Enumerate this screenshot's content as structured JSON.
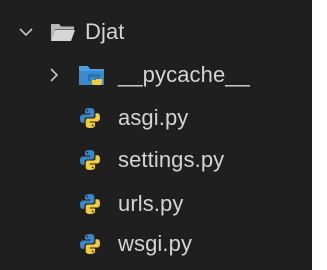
{
  "explorer": {
    "root_folder": {
      "name": "Djat",
      "expanded": true,
      "icon": "folder-open-icon"
    },
    "items": [
      {
        "name": "__pycache__",
        "type": "folder",
        "expanded": false,
        "icon": "pycache-folder-icon"
      },
      {
        "name": "asgi.py",
        "type": "file",
        "icon": "python-file-icon"
      },
      {
        "name": "settings.py",
        "type": "file",
        "icon": "python-file-icon"
      },
      {
        "name": "urls.py",
        "type": "file",
        "icon": "python-file-icon"
      },
      {
        "name": "wsgi.py",
        "type": "file",
        "icon": "python-file-icon"
      }
    ]
  },
  "colors": {
    "background": "#1f1f1f",
    "text": "#d4d4d4",
    "folder_gray": "#c5c5c5",
    "python_blue": "#3b86c8",
    "python_yellow": "#f2cd3c",
    "pycache_folder": "#4a9fe0"
  }
}
